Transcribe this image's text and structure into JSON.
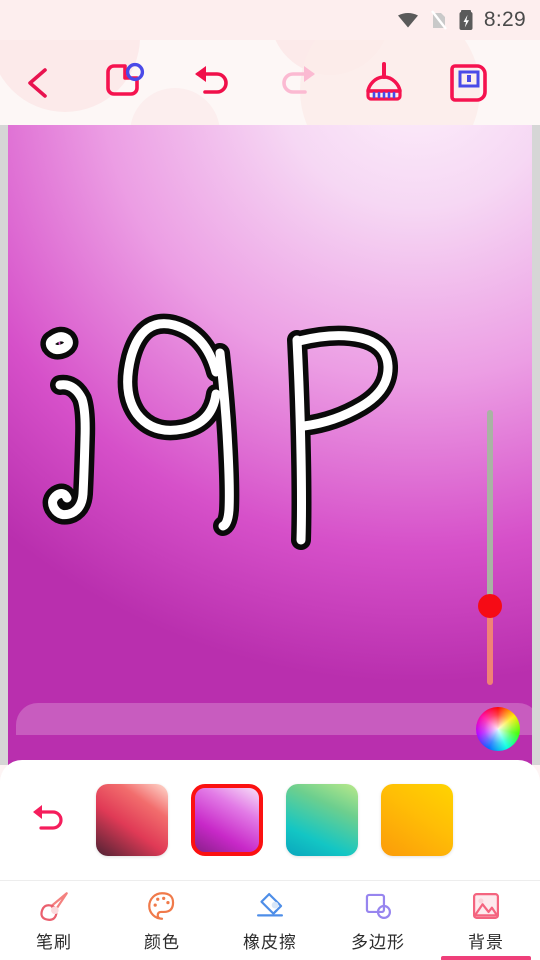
{
  "status_bar": {
    "time": "8:29",
    "icons": [
      "wifi-icon",
      "no-sim-icon",
      "battery-charging-icon"
    ]
  },
  "header": {
    "back_label": "back-chevron-icon",
    "tools": [
      {
        "name": "shape-layer-icon",
        "label": "Shape",
        "state": "enabled",
        "color": "#f5134f"
      },
      {
        "name": "undo-icon",
        "label": "Undo",
        "state": "enabled",
        "color": "#f5134f"
      },
      {
        "name": "redo-icon",
        "label": "Redo",
        "state": "disabled",
        "color": "#fbbad2"
      },
      {
        "name": "clear-broom-icon",
        "label": "Clear",
        "state": "enabled",
        "color": "#f5134f"
      },
      {
        "name": "save-icon",
        "label": "Save",
        "state": "enabled",
        "color": "#f5134f"
      }
    ]
  },
  "canvas": {
    "drawing_text": "j9P",
    "stroke_fill": "#ffffff",
    "stroke_outline": "#0a0a0a",
    "background_gradient_from": "#fdf0fb",
    "background_gradient_to": "#b92fae",
    "slider": {
      "name": "brush-size-slider",
      "value": 29,
      "min": 0,
      "max": 100,
      "track_color": "#a9b3a4",
      "fill_color": "#f08276",
      "thumb_color": "#f60b15"
    },
    "color_wheel": {
      "name": "color-wheel-picker"
    }
  },
  "background_panel": {
    "undo_label": "undo-arrow-icon",
    "swatches": [
      {
        "name": "swatch-red",
        "class": "sw-red",
        "selected": false
      },
      {
        "name": "swatch-purple",
        "class": "sw-purple",
        "selected": true
      },
      {
        "name": "swatch-green",
        "class": "sw-green",
        "selected": false
      },
      {
        "name": "swatch-orange",
        "class": "sw-orange",
        "selected": false
      }
    ],
    "selection_border_color": "#fb1111"
  },
  "bottom_nav": {
    "active_index": 4,
    "underline_color": "#ef3f7a",
    "items": [
      {
        "label": "笔刷",
        "icon": "brush-icon",
        "active": false
      },
      {
        "label": "颜色",
        "icon": "palette-icon",
        "active": false
      },
      {
        "label": "橡皮擦",
        "icon": "eraser-icon",
        "active": false
      },
      {
        "label": "多边形",
        "icon": "polygon-icon",
        "active": false
      },
      {
        "label": "背景",
        "icon": "image-icon",
        "active": true
      }
    ]
  }
}
